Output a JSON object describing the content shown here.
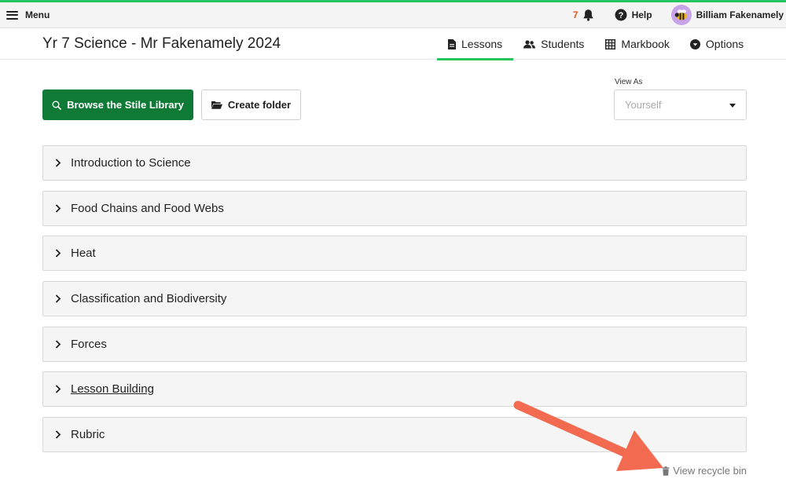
{
  "topbar": {
    "menu_label": "Menu",
    "notification_count": "7",
    "help_label": "Help",
    "user_name": "Billiam Fakenamely"
  },
  "header": {
    "title": "Yr 7 Science - Mr Fakenamely 2024",
    "tabs": [
      {
        "label": "Lessons",
        "icon": "document-icon",
        "active": true
      },
      {
        "label": "Students",
        "icon": "people-icon",
        "active": false
      },
      {
        "label": "Markbook",
        "icon": "grid-icon",
        "active": false
      },
      {
        "label": "Options",
        "icon": "caret-circle-icon",
        "active": false
      }
    ]
  },
  "actions": {
    "browse_label": "Browse the Stile Library",
    "create_folder_label": "Create folder"
  },
  "view_as": {
    "label": "View As",
    "selected": "Yourself"
  },
  "folders": [
    {
      "name": "Introduction to Science"
    },
    {
      "name": "Food Chains and Food Webs"
    },
    {
      "name": "Heat"
    },
    {
      "name": "Classification and Biodiversity"
    },
    {
      "name": "Forces"
    },
    {
      "name": "Lesson Building"
    },
    {
      "name": "Rubric"
    }
  ],
  "footer": {
    "recycle_label": "View recycle bin"
  },
  "colors": {
    "accent_green": "#22c55e",
    "button_green": "#0f7a36",
    "notification_orange": "#e5531a",
    "annotation_arrow": "#f26b50"
  }
}
